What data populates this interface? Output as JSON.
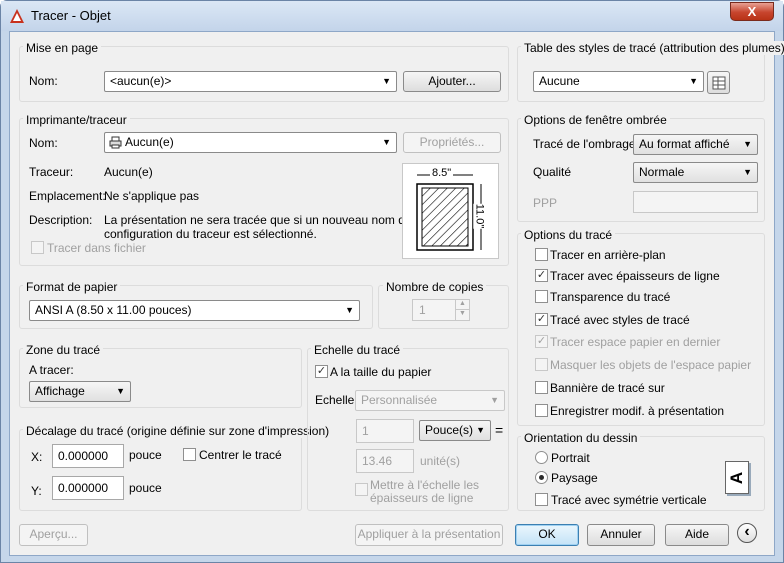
{
  "window": {
    "title": "Tracer - Objet",
    "close_glyph": "X"
  },
  "page_setup": {
    "group": "Mise en page",
    "name_label": "Nom:",
    "name_value": "<aucun(e)>",
    "add_button": "Ajouter..."
  },
  "printer": {
    "group": "Imprimante/traceur",
    "name_label": "Nom:",
    "name_value": "Aucun(e)",
    "properties_button": "Propriétés...",
    "plotter_label": "Traceur:",
    "plotter_value": "Aucun(e)",
    "location_label": "Emplacement:",
    "location_value": "Ne s'applique pas",
    "description_label": "Description:",
    "description_line1": "La présentation ne sera tracée que si un nouveau nom de",
    "description_line2": "configuration du traceur est sélectionné.",
    "plot_to_file": "Tracer dans fichier",
    "paper_width": "8.5\"",
    "paper_height": "11.0\""
  },
  "paper_size": {
    "group": "Format de papier",
    "value": "ANSI A (8.50 x 11.00 pouces)"
  },
  "copies": {
    "group": "Nombre de copies",
    "value": "1"
  },
  "plot_area": {
    "group": "Zone du tracé",
    "what_label": "A tracer:",
    "value": "Affichage"
  },
  "plot_offset": {
    "group": "Décalage du tracé (origine définie sur zone d'impression)",
    "x_label": "X:",
    "x_value": "0.000000",
    "x_unit": "pouce",
    "y_label": "Y:",
    "y_value": "0.000000",
    "y_unit": "pouce",
    "center_label": "Centrer le tracé"
  },
  "plot_scale": {
    "group": "Echelle du tracé",
    "fit_label": "A la taille du papier",
    "scale_label": "Echelle:",
    "scale_value": "Personnalisée",
    "num_value": "1",
    "unit_value": "Pouce(s)",
    "equals": "=",
    "den_value": "13.46",
    "den_unit": "unité(s)",
    "lineweights_line1": "Mettre à l'échelle les",
    "lineweights_line2": "épaisseurs de ligne"
  },
  "plot_style_table": {
    "group": "Table des styles de tracé (attribution des plumes)",
    "value": "Aucune"
  },
  "shaded_viewport": {
    "group": "Options de fenêtre ombrée",
    "shade_label": "Tracé de l'ombrage",
    "shade_value": "Au format affiché",
    "quality_label": "Qualité",
    "quality_value": "Normale",
    "dpi_label": "PPP",
    "dpi_value": ""
  },
  "plot_options": {
    "group": "Options du tracé",
    "items": [
      {
        "label": "Tracer en arrière-plan",
        "checked": "",
        "disabled": false
      },
      {
        "label": "Tracer avec épaisseurs de ligne",
        "checked": "✓",
        "disabled": false
      },
      {
        "label": "Transparence du tracé",
        "checked": "",
        "disabled": false
      },
      {
        "label": "Tracé avec styles de tracé",
        "checked": "✓",
        "disabled": false
      },
      {
        "label": "Tracer espace papier en dernier",
        "checked": "✓",
        "disabled": true
      },
      {
        "label": "Masquer les objets de l'espace papier",
        "checked": "",
        "disabled": true
      },
      {
        "label": "Bannière de tracé sur",
        "checked": "",
        "disabled": false
      },
      {
        "label": "Enregistrer modif. à présentation",
        "checked": "",
        "disabled": false
      }
    ]
  },
  "orientation": {
    "group": "Orientation du dessin",
    "portrait": "Portrait",
    "landscape": "Paysage",
    "upside_down": "Tracé avec symétrie verticale",
    "icon_letter": "A"
  },
  "buttons": {
    "preview": "Aperçu...",
    "apply": "Appliquer à la présentation",
    "ok": "OK",
    "cancel": "Annuler",
    "help": "Aide",
    "more": "‹"
  },
  "colors": {
    "title_bg": "#c5d6ea",
    "client_bg": "#f0f0f0",
    "close_red": "#c7452e",
    "default_border": "#3c7fb1"
  }
}
